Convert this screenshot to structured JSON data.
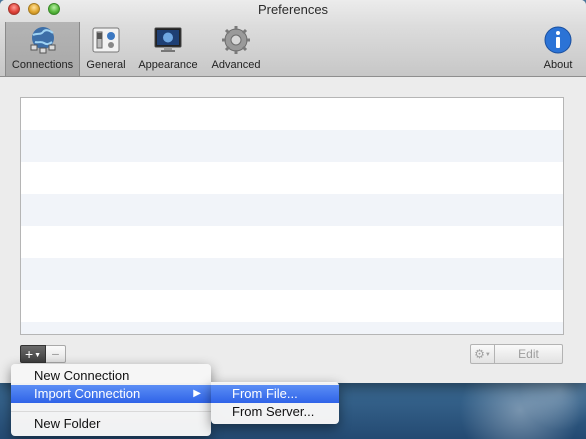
{
  "window": {
    "title": "Preferences"
  },
  "toolbar": {
    "items": [
      {
        "label": "Connections",
        "icon": "globe-network-icon",
        "selected": true
      },
      {
        "label": "General",
        "icon": "switches-icon",
        "selected": false
      },
      {
        "label": "Appearance",
        "icon": "monitor-icon",
        "selected": false
      },
      {
        "label": "Advanced",
        "icon": "gear-icon",
        "selected": false
      },
      {
        "label": "About",
        "icon": "info-icon",
        "selected": false
      }
    ]
  },
  "connections_list": {
    "rows": [
      "",
      "",
      "",
      "",
      "",
      "",
      ""
    ]
  },
  "bottom_bar": {
    "add_label": "+",
    "remove_label": "−",
    "gear_label": "⚙",
    "edit_label": "Edit"
  },
  "add_menu": {
    "items": [
      {
        "label": "New Connection"
      },
      {
        "label": "Import Connection",
        "submenu_arrow": "▶",
        "highlighted": true
      },
      {
        "label": "New Folder"
      }
    ],
    "import_submenu": {
      "items": [
        {
          "label": "From File...",
          "highlighted": true
        },
        {
          "label": "From Server..."
        }
      ]
    }
  },
  "colors": {
    "selection_blue": "#2f63e8",
    "list_alt_row": "#f1f4f9",
    "toolbar_selected": "#a8a8a8"
  }
}
